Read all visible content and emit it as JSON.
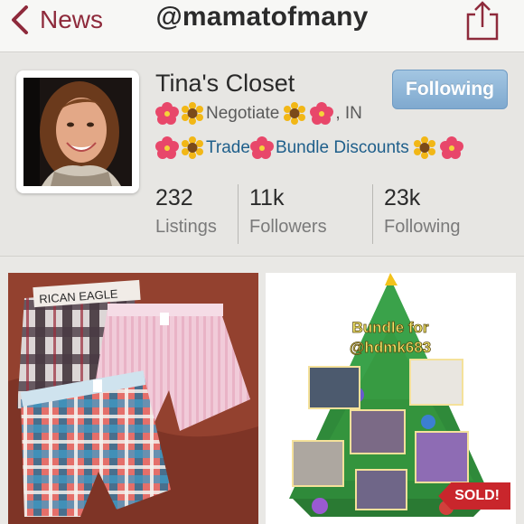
{
  "nav": {
    "back_label": "News",
    "title": "@mamatofmany"
  },
  "profile": {
    "closet_name": "Tina's Closet",
    "follow_button": "Following",
    "bio_line1": {
      "negotiate": "Negotiate",
      "suffix": ", IN"
    },
    "bio_line2": {
      "trade": "Trade",
      "bundle": "Bundle Discounts"
    }
  },
  "stats": [
    {
      "value": "232",
      "label": "Listings"
    },
    {
      "value": "11k",
      "label": "Followers"
    },
    {
      "value": "23k",
      "label": "Following"
    }
  ],
  "listings": [
    {
      "name": "boxer-shorts-listing"
    },
    {
      "name": "bundle-listing",
      "overlay_text": "Bundle for @hdmk683",
      "badge": "SOLD!"
    }
  ],
  "colors": {
    "accent": "#8e2a3b",
    "link": "#1f5f8b",
    "follow_button": "#8fb6da",
    "sold_badge": "#c9262c"
  },
  "icons": [
    "chevron-left-icon",
    "share-icon",
    "hibiscus-icon",
    "sunflower-icon"
  ]
}
